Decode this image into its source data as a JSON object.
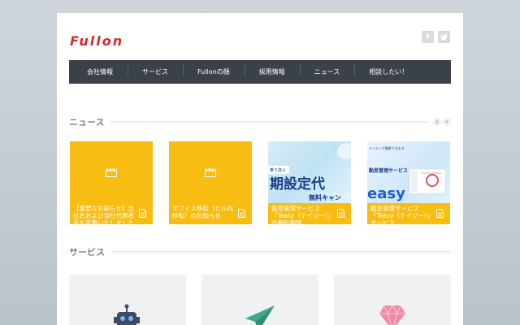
{
  "header": {
    "logo_text": "Fullon",
    "social": [
      {
        "icon": "facebook-icon",
        "glyph": "f"
      },
      {
        "icon": "twitter-icon",
        "glyph": "t"
      }
    ]
  },
  "nav": {
    "items": [
      {
        "label": "会社情報"
      },
      {
        "label": "サービス"
      },
      {
        "label": "Fullonの顔"
      },
      {
        "label": "採用情報"
      },
      {
        "label": "ニュース"
      },
      {
        "label": "相談したい！"
      }
    ]
  },
  "news": {
    "title": "ニュース",
    "prev": "‹",
    "next": "›",
    "cards": [
      {
        "caption": "【重要なお知らせ】当社名および当社代表者名を変更いたしました",
        "icon": "clapperboard-icon"
      },
      {
        "caption": "オフィス移転（ビル内移転）のお知らせ",
        "icon": "clapperboard-icon"
      },
      {
        "caption": "勤怠管理サービス「Teasy（テイジー）」の無料期間",
        "banner_main": "期設定代",
        "banner_sub": "無料キャン",
        "banner_tag": "乗り換え"
      },
      {
        "caption": "勤怠管理サービス「Teasy（テイジー）」サービス",
        "banner_main": "easy",
        "banner_sub": "勤怠管理サービス",
        "banner_tag": "テイジーで簡単できます"
      }
    ]
  },
  "services": {
    "title": "サービス",
    "items": [
      {
        "icon": "robot-icon"
      },
      {
        "icon": "paper-plane-icon"
      },
      {
        "icon": "diamond-icon"
      }
    ]
  },
  "colors": {
    "accent_red": "#d42b2b",
    "nav_bg": "#3a4148",
    "card_yellow": "#f7bd12"
  }
}
